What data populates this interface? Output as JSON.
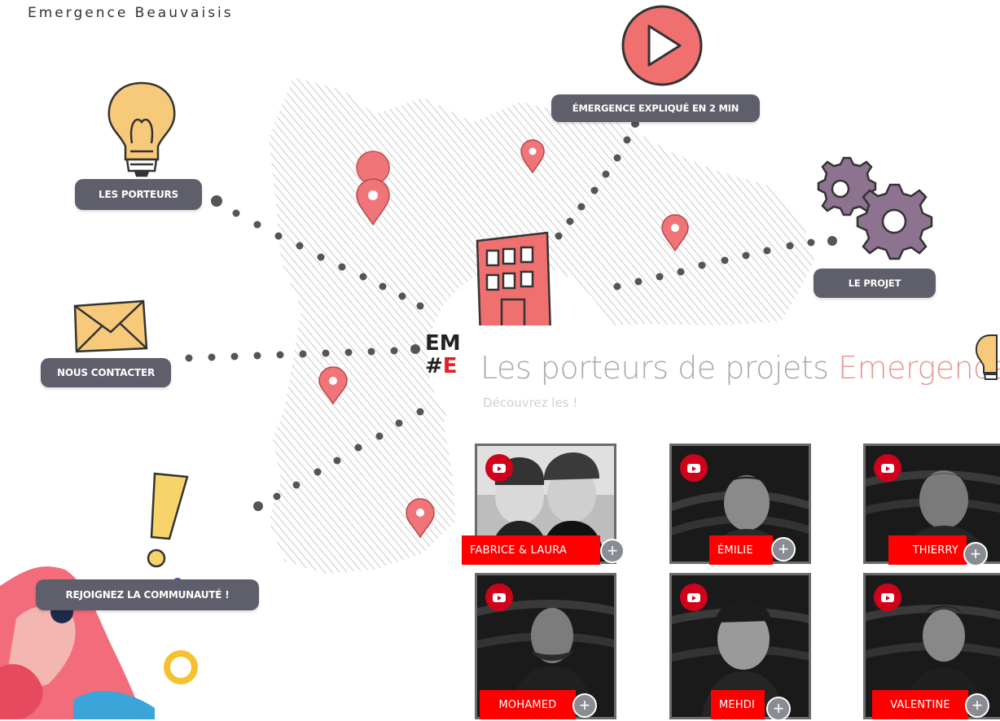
{
  "brand": {
    "name": "Emergence Beauvaisis"
  },
  "map": {
    "nav": {
      "porteurs": "LES PORTEURS",
      "video": "ÉMERGENCE EXPLIQUÉ EN 2 MIN",
      "projet": "LE PROJET",
      "contact": "NOUS CONTACTER",
      "communaute": "REJOIGNEZ LA COMMUNAUTÉ !"
    },
    "center_line1": "EM",
    "center_line2_prefix": "#",
    "center_line2_red": "E",
    "icons": [
      "lightbulb-icon",
      "play-icon",
      "gears-icon",
      "envelope-icon",
      "exclamation-icon",
      "building-icon",
      "map-pin-icon"
    ]
  },
  "section": {
    "title_main": "Les porteurs de projets ",
    "title_accent": "Emergence",
    "subtitle": "Découvrez les !"
  },
  "porteurs": [
    {
      "name": "FABRICE & LAURA"
    },
    {
      "name": "ÉMILIE"
    },
    {
      "name": "THIERRY"
    },
    {
      "name": "MOHAMED"
    },
    {
      "name": "MEHDI"
    },
    {
      "name": "VALENTINE"
    }
  ],
  "colors": {
    "accent_red": "#ff0000",
    "pill_gray": "#5e5f6b",
    "pin_pink": "#f07578",
    "title_gray": "#a9a9b1",
    "title_accent": "#e39a93"
  }
}
